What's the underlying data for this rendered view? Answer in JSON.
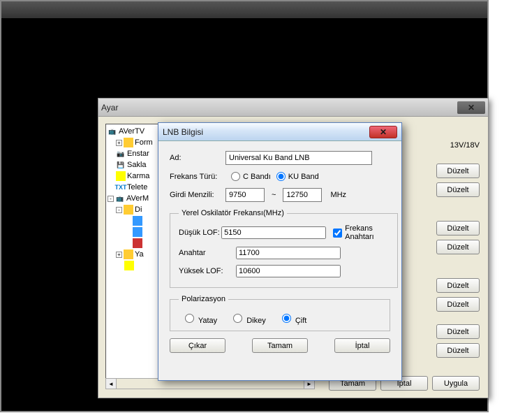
{
  "outer": {
    "title": "Ayar",
    "close": "✕"
  },
  "tree": {
    "root": "AVerTV",
    "items": [
      "Form",
      "Enstar",
      "Sakla",
      "Karma",
      "Telete"
    ],
    "root2": "AVerM",
    "sub1": "Di",
    "sub2": "Ya"
  },
  "right": {
    "voltage": "13V/18V",
    "edit": "Düzelt"
  },
  "bottom": {
    "ok": "Tamam",
    "cancel": "İptal",
    "apply": "Uygula"
  },
  "lnb": {
    "title": "LNB Bilgisi",
    "close": "✕",
    "name_label": "Ad:",
    "name_value": "Universal Ku Band LNB",
    "freq_type_label": "Frekans Türü:",
    "cband": "C Bandı",
    "kuband": "KU Band",
    "range_label": "Girdi Menzili:",
    "range_lo": "9750",
    "tilde": "~",
    "range_hi": "12750",
    "mhz": "MHz",
    "osc_legend": "Yerel Oskilatör Frekansı(MHz)",
    "low_lof_label": "Düşük LOF:",
    "low_lof": "5150",
    "freq_key": "Frekans Anahtarı",
    "switch_label": "Anahtar",
    "switch_val": "11700",
    "high_lof_label": "Yüksek LOF:",
    "high_lof": "10600",
    "pol_legend": "Polarizasyon",
    "pol_h": "Yatay",
    "pol_v": "Dikey",
    "pol_b": "Çift",
    "export": "Çıkar",
    "ok": "Tamam",
    "cancel": "İptal"
  }
}
